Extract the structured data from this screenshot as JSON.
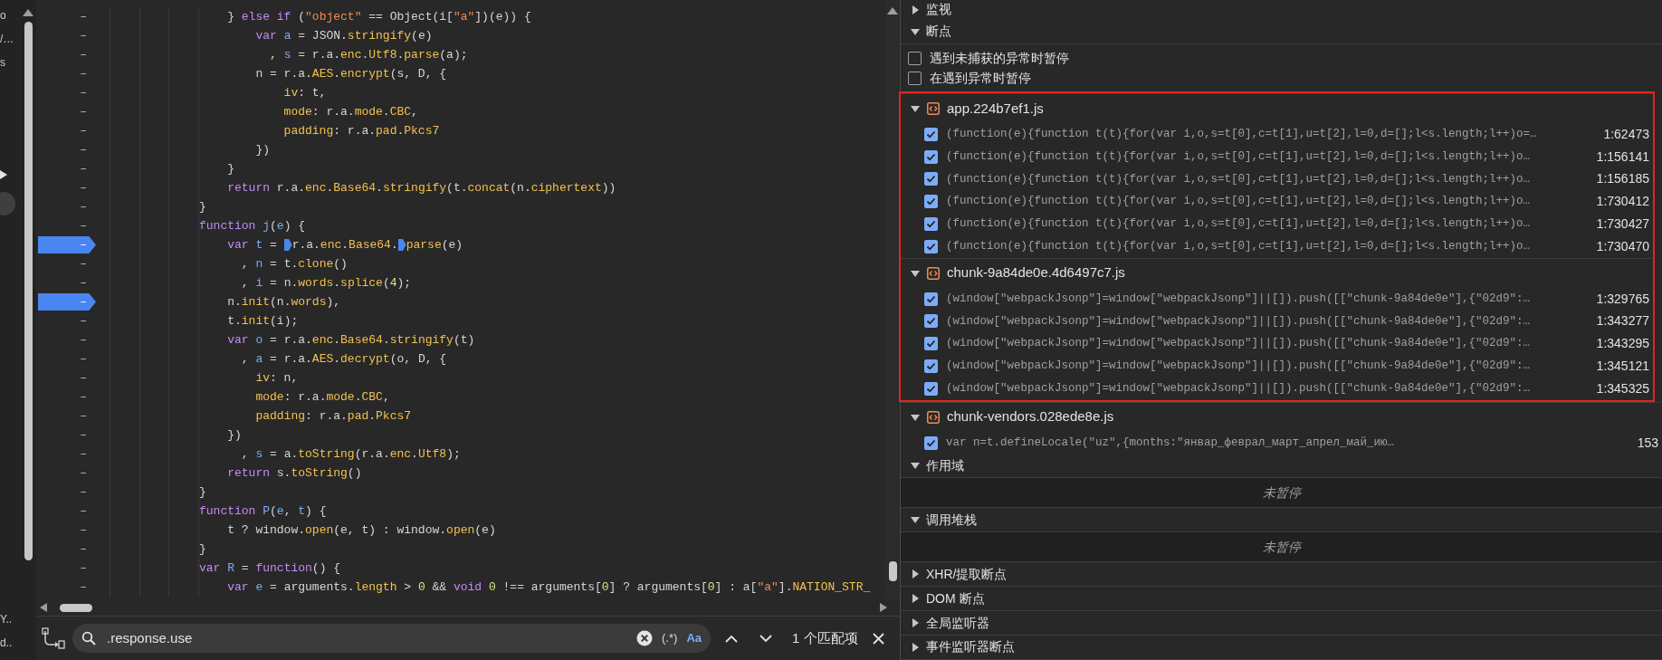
{
  "left_strip": {
    "fragments_top": [
      "o",
      "/…",
      "s"
    ],
    "fragments_bottom": [
      "Y..",
      "d.."
    ]
  },
  "editor": {
    "lines": [
      {
        "gutter": "–",
        "breakpoint": false,
        "tokens": [
          {
            "kind": "plain",
            "text": "    } "
          },
          {
            "kind": "keyword",
            "text": "else if"
          },
          {
            "kind": "plain",
            "text": " ("
          },
          {
            "kind": "string",
            "text": "\"object\""
          },
          {
            "kind": "plain",
            "text": " == Object(i["
          },
          {
            "kind": "string",
            "text": "\"a\""
          },
          {
            "kind": "plain",
            "text": "])(e)) {"
          }
        ]
      },
      {
        "gutter": "–",
        "breakpoint": false,
        "tokens": [
          {
            "kind": "keyword",
            "text": "        var "
          },
          {
            "kind": "name",
            "text": "a"
          },
          {
            "kind": "plain",
            "text": " = JSON."
          },
          {
            "kind": "property",
            "text": "stringify"
          },
          {
            "kind": "plain",
            "text": "(e)"
          }
        ]
      },
      {
        "gutter": "–",
        "breakpoint": false,
        "tokens": [
          {
            "kind": "plain",
            "text": "          , "
          },
          {
            "kind": "name",
            "text": "s"
          },
          {
            "kind": "plain",
            "text": " = r.a."
          },
          {
            "kind": "property",
            "text": "enc"
          },
          {
            "kind": "plain",
            "text": "."
          },
          {
            "kind": "property",
            "text": "Utf8"
          },
          {
            "kind": "plain",
            "text": "."
          },
          {
            "kind": "property",
            "text": "parse"
          },
          {
            "kind": "plain",
            "text": "(a);"
          }
        ]
      },
      {
        "gutter": "–",
        "breakpoint": false,
        "tokens": [
          {
            "kind": "plain",
            "text": "        n = r.a."
          },
          {
            "kind": "property",
            "text": "AES"
          },
          {
            "kind": "plain",
            "text": "."
          },
          {
            "kind": "property",
            "text": "encrypt"
          },
          {
            "kind": "plain",
            "text": "(s, D, {"
          }
        ]
      },
      {
        "gutter": "–",
        "breakpoint": false,
        "tokens": [
          {
            "kind": "property",
            "text": "            iv"
          },
          {
            "kind": "plain",
            "text": ": t,"
          }
        ]
      },
      {
        "gutter": "–",
        "breakpoint": false,
        "tokens": [
          {
            "kind": "property",
            "text": "            mode"
          },
          {
            "kind": "plain",
            "text": ": r.a."
          },
          {
            "kind": "property",
            "text": "mode"
          },
          {
            "kind": "plain",
            "text": "."
          },
          {
            "kind": "property",
            "text": "CBC"
          },
          {
            "kind": "plain",
            "text": ","
          }
        ]
      },
      {
        "gutter": "–",
        "breakpoint": false,
        "tokens": [
          {
            "kind": "property",
            "text": "            padding"
          },
          {
            "kind": "plain",
            "text": ": r.a."
          },
          {
            "kind": "property",
            "text": "pad"
          },
          {
            "kind": "plain",
            "text": "."
          },
          {
            "kind": "property",
            "text": "Pkcs7"
          }
        ]
      },
      {
        "gutter": "–",
        "breakpoint": false,
        "tokens": [
          {
            "kind": "plain",
            "text": "        })"
          }
        ]
      },
      {
        "gutter": "–",
        "breakpoint": false,
        "tokens": [
          {
            "kind": "plain",
            "text": "    }"
          }
        ]
      },
      {
        "gutter": "–",
        "breakpoint": false,
        "tokens": [
          {
            "kind": "keyword",
            "text": "    return"
          },
          {
            "kind": "plain",
            "text": " r.a."
          },
          {
            "kind": "property",
            "text": "enc"
          },
          {
            "kind": "plain",
            "text": "."
          },
          {
            "kind": "property",
            "text": "Base64"
          },
          {
            "kind": "plain",
            "text": "."
          },
          {
            "kind": "property",
            "text": "stringify"
          },
          {
            "kind": "plain",
            "text": "(t."
          },
          {
            "kind": "property",
            "text": "concat"
          },
          {
            "kind": "plain",
            "text": "(n."
          },
          {
            "kind": "property",
            "text": "ciphertext"
          },
          {
            "kind": "plain",
            "text": "))"
          }
        ]
      },
      {
        "gutter": "–",
        "breakpoint": false,
        "tokens": [
          {
            "kind": "plain",
            "text": "}"
          }
        ]
      },
      {
        "gutter": "–",
        "breakpoint": false,
        "tokens": [
          {
            "kind": "keyword",
            "text": "function "
          },
          {
            "kind": "name",
            "text": "j"
          },
          {
            "kind": "plain",
            "text": "("
          },
          {
            "kind": "name",
            "text": "e"
          },
          {
            "kind": "plain",
            "text": ") {"
          }
        ]
      },
      {
        "gutter": "–",
        "breakpoint": true,
        "tokens": [
          {
            "kind": "keyword",
            "text": "    var "
          },
          {
            "kind": "name",
            "text": "t"
          },
          {
            "kind": "plain",
            "text": " = "
          },
          {
            "kind": "breakpoint"
          },
          {
            "kind": "plain",
            "text": "r.a."
          },
          {
            "kind": "property",
            "text": "enc"
          },
          {
            "kind": "plain",
            "text": "."
          },
          {
            "kind": "property",
            "text": "Base64"
          },
          {
            "kind": "plain",
            "text": "."
          },
          {
            "kind": "breakpoint"
          },
          {
            "kind": "property",
            "text": "parse"
          },
          {
            "kind": "plain",
            "text": "(e)"
          }
        ]
      },
      {
        "gutter": "–",
        "breakpoint": false,
        "tokens": [
          {
            "kind": "plain",
            "text": "      , "
          },
          {
            "kind": "name",
            "text": "n"
          },
          {
            "kind": "plain",
            "text": " = t."
          },
          {
            "kind": "property",
            "text": "clone"
          },
          {
            "kind": "plain",
            "text": "()"
          }
        ]
      },
      {
        "gutter": "–",
        "breakpoint": false,
        "tokens": [
          {
            "kind": "plain",
            "text": "      , "
          },
          {
            "kind": "name",
            "text": "i"
          },
          {
            "kind": "plain",
            "text": " = n."
          },
          {
            "kind": "property",
            "text": "words"
          },
          {
            "kind": "plain",
            "text": "."
          },
          {
            "kind": "property",
            "text": "splice"
          },
          {
            "kind": "plain",
            "text": "("
          },
          {
            "kind": "number",
            "text": "4"
          },
          {
            "kind": "plain",
            "text": ");"
          }
        ]
      },
      {
        "gutter": "–",
        "breakpoint": true,
        "tokens": [
          {
            "kind": "plain",
            "text": "    n."
          },
          {
            "kind": "property",
            "text": "init"
          },
          {
            "kind": "plain",
            "text": "(n."
          },
          {
            "kind": "property",
            "text": "words"
          },
          {
            "kind": "plain",
            "text": "),"
          }
        ]
      },
      {
        "gutter": "–",
        "breakpoint": false,
        "tokens": [
          {
            "kind": "plain",
            "text": "    t."
          },
          {
            "kind": "property",
            "text": "init"
          },
          {
            "kind": "plain",
            "text": "(i);"
          }
        ]
      },
      {
        "gutter": "–",
        "breakpoint": false,
        "tokens": [
          {
            "kind": "keyword",
            "text": "    var "
          },
          {
            "kind": "name",
            "text": "o"
          },
          {
            "kind": "plain",
            "text": " = r.a."
          },
          {
            "kind": "property",
            "text": "enc"
          },
          {
            "kind": "plain",
            "text": "."
          },
          {
            "kind": "property",
            "text": "Base64"
          },
          {
            "kind": "plain",
            "text": "."
          },
          {
            "kind": "property",
            "text": "stringify"
          },
          {
            "kind": "plain",
            "text": "(t)"
          }
        ]
      },
      {
        "gutter": "–",
        "breakpoint": false,
        "tokens": [
          {
            "kind": "plain",
            "text": "      , "
          },
          {
            "kind": "name",
            "text": "a"
          },
          {
            "kind": "plain",
            "text": " = r.a."
          },
          {
            "kind": "property",
            "text": "AES"
          },
          {
            "kind": "plain",
            "text": "."
          },
          {
            "kind": "property",
            "text": "decrypt"
          },
          {
            "kind": "plain",
            "text": "(o, D, {"
          }
        ]
      },
      {
        "gutter": "–",
        "breakpoint": false,
        "tokens": [
          {
            "kind": "property",
            "text": "        iv"
          },
          {
            "kind": "plain",
            "text": ": n,"
          }
        ]
      },
      {
        "gutter": "–",
        "breakpoint": false,
        "tokens": [
          {
            "kind": "property",
            "text": "        mode"
          },
          {
            "kind": "plain",
            "text": ": r.a."
          },
          {
            "kind": "property",
            "text": "mode"
          },
          {
            "kind": "plain",
            "text": "."
          },
          {
            "kind": "property",
            "text": "CBC"
          },
          {
            "kind": "plain",
            "text": ","
          }
        ]
      },
      {
        "gutter": "–",
        "breakpoint": false,
        "tokens": [
          {
            "kind": "property",
            "text": "        padding"
          },
          {
            "kind": "plain",
            "text": ": r.a."
          },
          {
            "kind": "property",
            "text": "pad"
          },
          {
            "kind": "plain",
            "text": "."
          },
          {
            "kind": "property",
            "text": "Pkcs7"
          }
        ]
      },
      {
        "gutter": "–",
        "breakpoint": false,
        "tokens": [
          {
            "kind": "plain",
            "text": "    })"
          }
        ]
      },
      {
        "gutter": "–",
        "breakpoint": false,
        "tokens": [
          {
            "kind": "plain",
            "text": "      , "
          },
          {
            "kind": "name",
            "text": "s"
          },
          {
            "kind": "plain",
            "text": " = a."
          },
          {
            "kind": "property",
            "text": "toString"
          },
          {
            "kind": "plain",
            "text": "(r.a."
          },
          {
            "kind": "property",
            "text": "enc"
          },
          {
            "kind": "plain",
            "text": "."
          },
          {
            "kind": "property",
            "text": "Utf8"
          },
          {
            "kind": "plain",
            "text": ");"
          }
        ]
      },
      {
        "gutter": "–",
        "breakpoint": false,
        "tokens": [
          {
            "kind": "keyword",
            "text": "    return"
          },
          {
            "kind": "plain",
            "text": " s."
          },
          {
            "kind": "property",
            "text": "toString"
          },
          {
            "kind": "plain",
            "text": "()"
          }
        ]
      },
      {
        "gutter": "–",
        "breakpoint": false,
        "tokens": [
          {
            "kind": "plain",
            "text": "}"
          }
        ]
      },
      {
        "gutter": "–",
        "breakpoint": false,
        "tokens": [
          {
            "kind": "keyword",
            "text": "function "
          },
          {
            "kind": "name",
            "text": "P"
          },
          {
            "kind": "plain",
            "text": "("
          },
          {
            "kind": "name",
            "text": "e"
          },
          {
            "kind": "plain",
            "text": ", "
          },
          {
            "kind": "name",
            "text": "t"
          },
          {
            "kind": "plain",
            "text": ") {"
          }
        ]
      },
      {
        "gutter": "–",
        "breakpoint": false,
        "tokens": [
          {
            "kind": "plain",
            "text": "    t ? window."
          },
          {
            "kind": "property",
            "text": "open"
          },
          {
            "kind": "plain",
            "text": "(e, t) : window."
          },
          {
            "kind": "property",
            "text": "open"
          },
          {
            "kind": "plain",
            "text": "(e)"
          }
        ]
      },
      {
        "gutter": "–",
        "breakpoint": false,
        "tokens": [
          {
            "kind": "plain",
            "text": "}"
          }
        ]
      },
      {
        "gutter": "–",
        "breakpoint": false,
        "tokens": [
          {
            "kind": "keyword",
            "text": "var "
          },
          {
            "kind": "name",
            "text": "R"
          },
          {
            "kind": "plain",
            "text": " = "
          },
          {
            "kind": "keyword",
            "text": "function"
          },
          {
            "kind": "plain",
            "text": "() {"
          }
        ]
      },
      {
        "gutter": "–",
        "breakpoint": false,
        "tokens": [
          {
            "kind": "keyword",
            "text": "    var "
          },
          {
            "kind": "name",
            "text": "e"
          },
          {
            "kind": "plain",
            "text": " = arguments."
          },
          {
            "kind": "property",
            "text": "length"
          },
          {
            "kind": "plain",
            "text": " > "
          },
          {
            "kind": "number",
            "text": "0"
          },
          {
            "kind": "plain",
            "text": " && "
          },
          {
            "kind": "keyword",
            "text": "void "
          },
          {
            "kind": "number",
            "text": "0"
          },
          {
            "kind": "plain",
            "text": " !== arguments["
          },
          {
            "kind": "number",
            "text": "0"
          },
          {
            "kind": "plain",
            "text": "] ? arguments["
          },
          {
            "kind": "number",
            "text": "0"
          },
          {
            "kind": "plain",
            "text": "] : a["
          },
          {
            "kind": "string",
            "text": "\"a\""
          },
          {
            "kind": "plain",
            "text": "]."
          },
          {
            "kind": "property",
            "text": "NATION_STR_"
          }
        ]
      }
    ]
  },
  "search_bar": {
    "value": ".response.use",
    "regex_label": "(.*)",
    "case_label": "Aa",
    "match_count": "1 个匹配项"
  },
  "debugger_panel": {
    "sections": [
      {
        "title": "监视",
        "expanded": false
      },
      {
        "title": "断点",
        "expanded": true,
        "options": [
          {
            "label": "遇到未捕获的异常时暂停",
            "checked": false
          },
          {
            "label": "在遇到异常时暂停",
            "checked": false
          }
        ],
        "files": [
          {
            "name": "app.224b7ef1.js",
            "expanded": true,
            "highlighted": true,
            "breakpoints": [
              {
                "code": "(function(e){function t(t){for(var i,o,s=t[0],c=t[1],u=t[2],l=0,d=[];l<s.length;l++)o=…",
                "location": "1:62473",
                "checked": true
              },
              {
                "code": "(function(e){function t(t){for(var i,o,s=t[0],c=t[1],u=t[2],l=0,d=[];l<s.length;l++)o…",
                "location": "1:156141",
                "checked": true
              },
              {
                "code": "(function(e){function t(t){for(var i,o,s=t[0],c=t[1],u=t[2],l=0,d=[];l<s.length;l++)o…",
                "location": "1:156185",
                "checked": true
              },
              {
                "code": "(function(e){function t(t){for(var i,o,s=t[0],c=t[1],u=t[2],l=0,d=[];l<s.length;l++)o…",
                "location": "1:730412",
                "checked": true
              },
              {
                "code": "(function(e){function t(t){for(var i,o,s=t[0],c=t[1],u=t[2],l=0,d=[];l<s.length;l++)o…",
                "location": "1:730427",
                "checked": true
              },
              {
                "code": "(function(e){function t(t){for(var i,o,s=t[0],c=t[1],u=t[2],l=0,d=[];l<s.length;l++)o…",
                "location": "1:730470",
                "checked": true
              }
            ]
          },
          {
            "name": "chunk-9a84de0e.4d6497c7.js",
            "expanded": true,
            "highlighted": true,
            "breakpoints": [
              {
                "code": "(window[\"webpackJsonp\"]=window[\"webpackJsonp\"]||[]).push([[\"chunk-9a84de0e\"],{\"02d9\":…",
                "location": "1:329765",
                "checked": true
              },
              {
                "code": "(window[\"webpackJsonp\"]=window[\"webpackJsonp\"]||[]).push([[\"chunk-9a84de0e\"],{\"02d9\":…",
                "location": "1:343277",
                "checked": true
              },
              {
                "code": "(window[\"webpackJsonp\"]=window[\"webpackJsonp\"]||[]).push([[\"chunk-9a84de0e\"],{\"02d9\":…",
                "location": "1:343295",
                "checked": true
              },
              {
                "code": "(window[\"webpackJsonp\"]=window[\"webpackJsonp\"]||[]).push([[\"chunk-9a84de0e\"],{\"02d9\":…",
                "location": "1:345121",
                "checked": true
              },
              {
                "code": "(window[\"webpackJsonp\"]=window[\"webpackJsonp\"]||[]).push([[\"chunk-9a84de0e\"],{\"02d9\":…",
                "location": "1:345325",
                "checked": true
              }
            ]
          },
          {
            "name": "chunk-vendors.028ede8e.js",
            "expanded": true,
            "highlighted": false,
            "breakpoints": [
              {
                "code": "var n=t.defineLocale(\"uz\",{months:\"январ_феврал_март_апрел_май_ию…",
                "location": "153",
                "checked": true
              }
            ]
          }
        ]
      },
      {
        "title": "作用域",
        "expanded": true,
        "message": "未暂停"
      },
      {
        "title": "调用堆栈",
        "expanded": true,
        "message": "未暂停"
      },
      {
        "title": "XHR/提取断点",
        "expanded": false
      },
      {
        "title": "DOM 断点",
        "expanded": false
      },
      {
        "title": "全局监听器",
        "expanded": false
      },
      {
        "title": "事件监听器断点",
        "expanded": false
      }
    ]
  }
}
